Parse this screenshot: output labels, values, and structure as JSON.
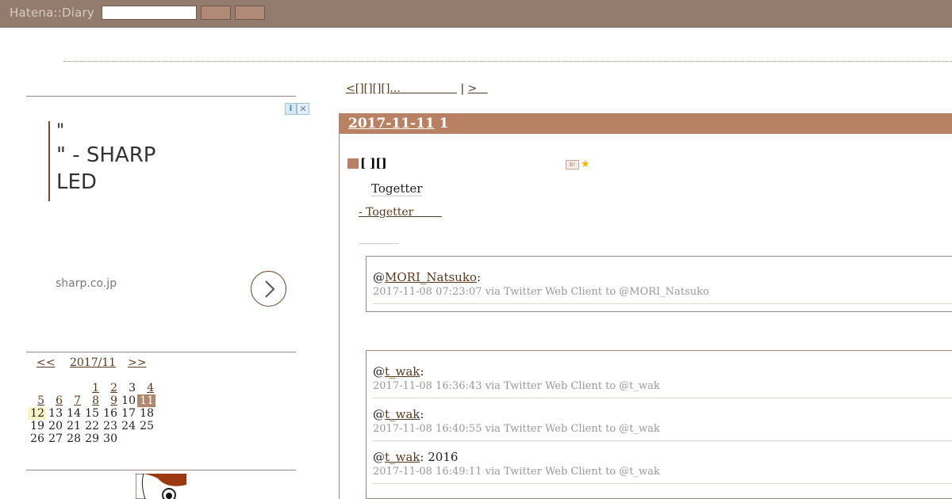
{
  "header": {
    "logo": "Hatena::Diary",
    "search_placeholder": "",
    "button1_label": "",
    "button2_label": ""
  },
  "ad": {
    "lines": [
      "\"",
      "\" - SHARP",
      "LED"
    ],
    "domain": "sharp.co.jp",
    "info_icon": "i",
    "close_icon": "✕"
  },
  "calendar": {
    "prev": "<<",
    "month": "2017/11",
    "next": ">>",
    "weeks": [
      [
        {
          "d": "",
          "link": false
        },
        {
          "d": "",
          "link": false
        },
        {
          "d": "",
          "link": false
        },
        {
          "d": "1",
          "link": true
        },
        {
          "d": "2",
          "link": true
        },
        {
          "d": "3",
          "link": false
        },
        {
          "d": "4",
          "link": true
        }
      ],
      [
        {
          "d": "5",
          "link": true
        },
        {
          "d": "6",
          "link": true
        },
        {
          "d": "7",
          "link": true
        },
        {
          "d": "8",
          "link": true
        },
        {
          "d": "9",
          "link": true
        },
        {
          "d": "10",
          "link": false
        },
        {
          "d": "11",
          "link": true,
          "today": true
        }
      ],
      [
        {
          "d": "12",
          "link": false,
          "hl": true
        },
        {
          "d": "13",
          "link": false
        },
        {
          "d": "14",
          "link": false
        },
        {
          "d": "15",
          "link": false
        },
        {
          "d": "16",
          "link": false
        },
        {
          "d": "17",
          "link": false
        },
        {
          "d": "18",
          "link": false
        }
      ],
      [
        {
          "d": "19",
          "link": false
        },
        {
          "d": "20",
          "link": false
        },
        {
          "d": "21",
          "link": false
        },
        {
          "d": "22",
          "link": false
        },
        {
          "d": "23",
          "link": false
        },
        {
          "d": "24",
          "link": false
        },
        {
          "d": "25",
          "link": false
        }
      ],
      [
        {
          "d": "26",
          "link": false
        },
        {
          "d": "27",
          "link": false
        },
        {
          "d": "28",
          "link": false
        },
        {
          "d": "29",
          "link": false
        },
        {
          "d": "30",
          "link": false
        },
        {
          "d": "",
          "link": false
        },
        {
          "d": "",
          "link": false
        }
      ]
    ]
  },
  "pager": {
    "prev": "<[][][][]...",
    "sep": "|",
    "next": ">"
  },
  "day": {
    "date": "2017-11-11",
    "count": "1"
  },
  "section": {
    "title": "[ ][]",
    "togetter": "Togetter",
    "togetter_link": "- Togetter"
  },
  "tweets_group1": [
    {
      "at": "@",
      "user": "MORI_Natsuko",
      "text": ":",
      "meta": "2017-11-08 07:23:07 via Twitter Web Client to @MORI_Natsuko"
    }
  ],
  "tweets_group2": [
    {
      "at": "@",
      "user": "t_wak",
      "text": ":",
      "meta": "2017-11-08 16:36:43 via Twitter Web Client to @t_wak"
    },
    {
      "at": "@",
      "user": "t_wak",
      "text": ":",
      "meta": "2017-11-08 16:40:55 via Twitter Web Client to @t_wak"
    },
    {
      "at": "@",
      "user": "t_wak",
      "text": ": 2016",
      "meta": "2017-11-08 16:49:11 via Twitter Web Client to @t_wak"
    }
  ],
  "colors": {
    "topbar": "#937b6d",
    "accent": "#b88164",
    "link": "#5a3a1e",
    "star": "#f2b400"
  }
}
